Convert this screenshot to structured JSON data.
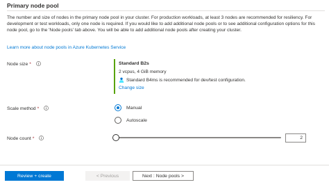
{
  "section": {
    "title": "Primary node pool",
    "description": "The number and size of nodes in the primary node pool in your cluster. For production workloads, at least 3 nodes are recommended for resiliency. For development or test workloads, only one node is required. If you would like to add additional node pools or to see additional configuration options for this node pool, go to the 'Node pools' tab above. You will be able to add additional node pools after creating your cluster.",
    "learn_more": "Learn more about node pools in Azure Kubernetes Service"
  },
  "node_size": {
    "label": "Node size",
    "required_mark": "*",
    "name": "Standard B2s",
    "spec": "2 vcpus, 4 GiB memory",
    "recommendation": "Standard B4ms is recommended for dev/test configuration.",
    "change_link": "Change size",
    "accent_color": "#57a300"
  },
  "scale_method": {
    "label": "Scale method",
    "required_mark": "*",
    "options": [
      {
        "label": "Manual",
        "selected": true
      },
      {
        "label": "Autoscale",
        "selected": false
      }
    ]
  },
  "node_count": {
    "label": "Node count",
    "required_mark": "*",
    "value": "2",
    "slider_fraction": 0.0
  },
  "footer": {
    "review_create": "Review + create",
    "previous": "< Previous",
    "next": "Next : Node pools >"
  },
  "colors": {
    "primary": "#0078d4",
    "link": "#0078d4",
    "required": "#a4262c"
  },
  "icons": {
    "info": "info-circle-icon",
    "recommendation": "person-icon"
  }
}
